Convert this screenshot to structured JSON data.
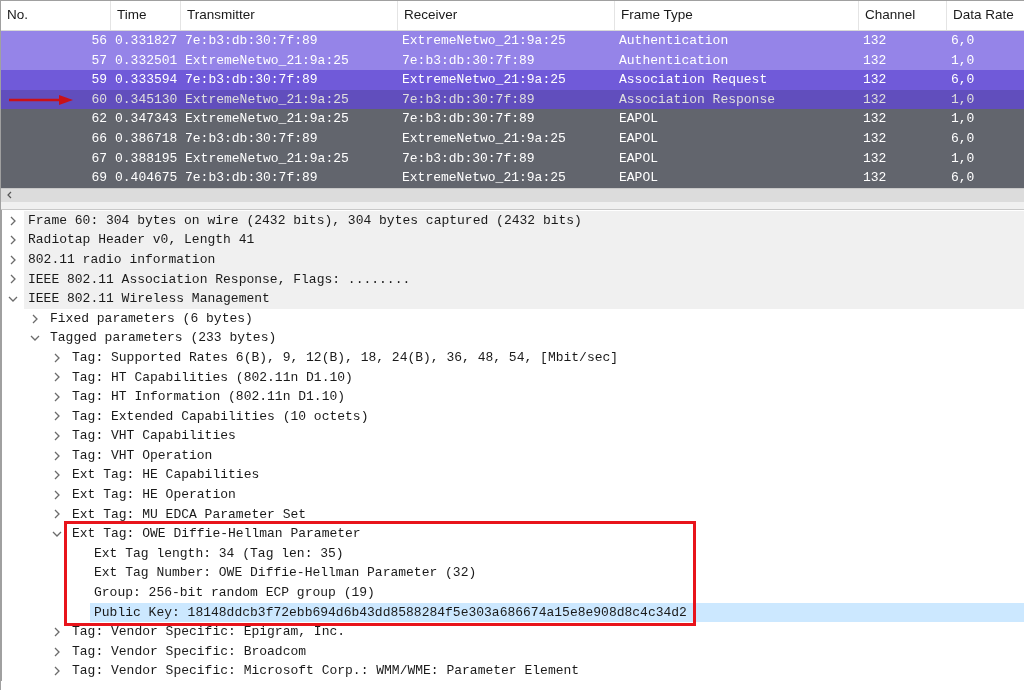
{
  "packet_list": {
    "columns": [
      "No.",
      "Time",
      "Transmitter",
      "Receiver",
      "Frame Type",
      "Channel",
      "Data Rate"
    ],
    "rows": [
      {
        "cells": [
          "56",
          "0.331827",
          "7e:b3:db:30:7f:89",
          "ExtremeNetwo_21:9a:25",
          "Authentication",
          "132",
          "6,0"
        ],
        "color": "#9584e8",
        "selected": false,
        "marked": false
      },
      {
        "cells": [
          "57",
          "0.332501",
          "ExtremeNetwo_21:9a:25",
          "7e:b3:db:30:7f:89",
          "Authentication",
          "132",
          "1,0"
        ],
        "color": "#9584e8",
        "selected": false,
        "marked": false
      },
      {
        "cells": [
          "59",
          "0.333594",
          "7e:b3:db:30:7f:89",
          "ExtremeNetwo_21:9a:25",
          "Association Request",
          "132",
          "6,0"
        ],
        "color": "#705ad9",
        "selected": false,
        "marked": false
      },
      {
        "cells": [
          "60",
          "0.345130",
          "ExtremeNetwo_21:9a:25",
          "7e:b3:db:30:7f:89",
          "Association Response",
          "132",
          "1,0"
        ],
        "color": "#705ad9",
        "selected": true,
        "marked": true
      },
      {
        "cells": [
          "62",
          "0.347343",
          "ExtremeNetwo_21:9a:25",
          "7e:b3:db:30:7f:89",
          "EAPOL",
          "132",
          "1,0"
        ],
        "color": "#62656d",
        "selected": false,
        "marked": false
      },
      {
        "cells": [
          "66",
          "0.386718",
          "7e:b3:db:30:7f:89",
          "ExtremeNetwo_21:9a:25",
          "EAPOL",
          "132",
          "6,0"
        ],
        "color": "#62656d",
        "selected": false,
        "marked": false
      },
      {
        "cells": [
          "67",
          "0.388195",
          "ExtremeNetwo_21:9a:25",
          "7e:b3:db:30:7f:89",
          "EAPOL",
          "132",
          "1,0"
        ],
        "color": "#62656d",
        "selected": false,
        "marked": false
      },
      {
        "cells": [
          "69",
          "0.404675",
          "7e:b3:db:30:7f:89",
          "ExtremeNetwo_21:9a:25",
          "EAPOL",
          "132",
          "6,0"
        ],
        "color": "#62656d",
        "selected": false,
        "marked": false
      }
    ]
  },
  "details": [
    {
      "label": "Frame 60: 304 bytes on wire (2432 bits), 304 bytes captured (2432 bits)",
      "expanded": false,
      "selected": false
    },
    {
      "label": "Radiotap Header v0, Length 41",
      "expanded": false,
      "selected": false
    },
    {
      "label": "802.11 radio information",
      "expanded": false,
      "selected": false
    },
    {
      "label": "IEEE 802.11 Association Response, Flags: ........",
      "expanded": false,
      "selected": false
    },
    {
      "label": "IEEE 802.11 Wireless Management",
      "expanded": true,
      "selected": false,
      "children": [
        {
          "label": "Fixed parameters (6 bytes)",
          "expanded": false,
          "selected": false
        },
        {
          "label": "Tagged parameters (233 bytes)",
          "expanded": true,
          "selected": false,
          "children": [
            {
              "label": "Tag: Supported Rates 6(B), 9, 12(B), 18, 24(B), 36, 48, 54, [Mbit/sec]",
              "expanded": false,
              "selected": false
            },
            {
              "label": "Tag: HT Capabilities (802.11n D1.10)",
              "expanded": false,
              "selected": false
            },
            {
              "label": "Tag: HT Information (802.11n D1.10)",
              "expanded": false,
              "selected": false
            },
            {
              "label": "Tag: Extended Capabilities (10 octets)",
              "expanded": false,
              "selected": false
            },
            {
              "label": "Tag: VHT Capabilities",
              "expanded": false,
              "selected": false
            },
            {
              "label": "Tag: VHT Operation",
              "expanded": false,
              "selected": false
            },
            {
              "label": "Ext Tag: HE Capabilities",
              "expanded": false,
              "selected": false
            },
            {
              "label": "Ext Tag: HE Operation",
              "expanded": false,
              "selected": false
            },
            {
              "label": "Ext Tag: MU EDCA Parameter Set",
              "expanded": false,
              "selected": false
            },
            {
              "label": "Ext Tag: OWE Diffie-Hellman Parameter",
              "expanded": true,
              "selected": false,
              "boxed": true,
              "children": [
                {
                  "label": "Ext Tag length: 34 (Tag len: 35)",
                  "selected": false
                },
                {
                  "label": "Ext Tag Number: OWE Diffie-Hellman Parameter (32)",
                  "selected": false
                },
                {
                  "label": "Group: 256-bit random ECP group (19)",
                  "selected": false
                },
                {
                  "label": "Public Key: 18148ddcb3f72ebb694d6b43dd8588284f5e303a686674a15e8e908d8c4c34d2",
                  "selected": true
                }
              ]
            },
            {
              "label": "Tag: Vendor Specific: Epigram, Inc.",
              "expanded": false,
              "selected": false
            },
            {
              "label": "Tag: Vendor Specific: Broadcom",
              "expanded": false,
              "selected": false
            },
            {
              "label": "Tag: Vendor Specific: Microsoft Corp.: WMM/WME: Parameter Element",
              "expanded": false,
              "selected": false
            }
          ]
        }
      ]
    }
  ]
}
